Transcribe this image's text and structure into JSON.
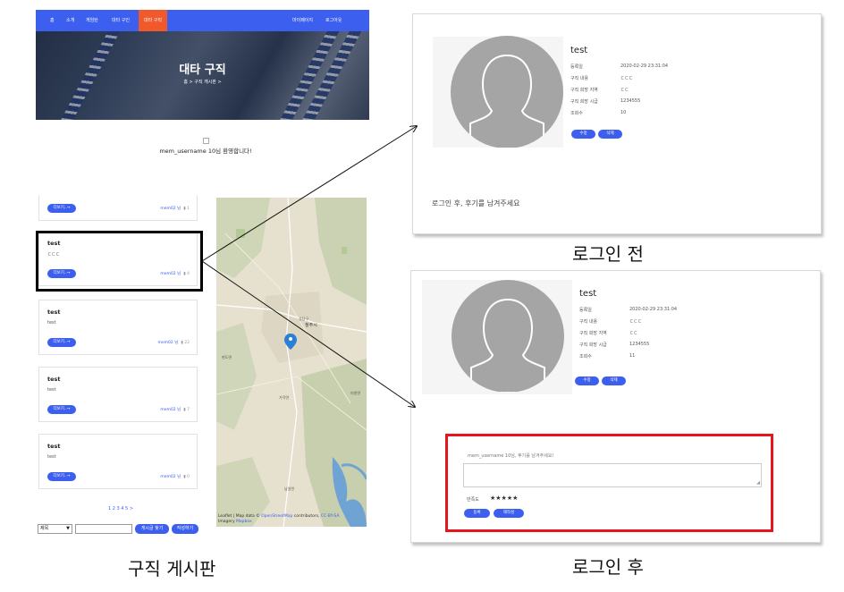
{
  "nav": {
    "items": [
      "홈",
      "소개",
      "게임탄",
      "대타 구인",
      "대타 구직",
      "마이페이지",
      "로그아웃"
    ],
    "active_label": "대타 구직"
  },
  "hero": {
    "title": "대타 구직",
    "breadcrumb": "홈 > 구직 게시판 >"
  },
  "welcome": {
    "text": "mem_username 10님 환영합니다!"
  },
  "board": {
    "more_label": "더보기..→",
    "top_card": {
      "author": "mem02 님",
      "count": "1"
    },
    "cards": [
      {
        "title": "test",
        "content": "ㄷㄷㄷ",
        "author": "mem02 님",
        "count": "4"
      },
      {
        "title": "test",
        "content": "test",
        "author": "mem02 님",
        "count": "22"
      },
      {
        "title": "test",
        "content": "test",
        "author": "mem02 님",
        "count": "7"
      },
      {
        "title": "test",
        "content": "test",
        "author": "mem02 님",
        "count": "0"
      }
    ],
    "pagination": "1 2 3 4 5 >",
    "search_select": "제목",
    "search_button": "게시글 찾기",
    "write_button": "작성하기"
  },
  "map": {
    "labels": [
      "청주시",
      "상당구",
      "가덕면",
      "현도면",
      "남일면",
      "미원면"
    ],
    "attribution_prefix": "Leaflet | Map data © ",
    "attribution_osm": "OpenStreetMap",
    "attribution_mid": " contributors, ",
    "attribution_license": "CC-BY-SA",
    "attribution_imagery": "Imagery ",
    "attribution_mapbox": "Mapbox"
  },
  "captions": {
    "board": "구직 게시판",
    "before": "로그인 전",
    "after": "로그인 후"
  },
  "before": {
    "title": "test",
    "rows": [
      {
        "label": "등록일",
        "value": "2020-02-29 23:31:04"
      },
      {
        "label": "구직 내용",
        "value": "ㄷㄷㄷ"
      },
      {
        "label": "구직 희망 지역",
        "value": "ㄷㄷ"
      },
      {
        "label": "구직 희망 시급",
        "value": "1234555"
      },
      {
        "label": "조회수",
        "value": "10"
      }
    ],
    "edit_label": "수정",
    "delete_label": "삭제",
    "login_prompt": "로그인 후, 후기를 남겨주세요"
  },
  "after": {
    "title": "test",
    "rows": [
      {
        "label": "등록일",
        "value": "2020-02-29 23:31:04"
      },
      {
        "label": "구직 내용",
        "value": "ㄷㄷㄷ"
      },
      {
        "label": "구직 희망 지역",
        "value": "ㄷㄷ"
      },
      {
        "label": "구직 희망 시급",
        "value": "1234555"
      },
      {
        "label": "조회수",
        "value": "11"
      }
    ],
    "edit_label": "수정",
    "delete_label": "삭제",
    "review_placeholder": "mem_username 10님, 후기를 남겨주세요!",
    "rating_label": "만족도",
    "stars": "★★★★★",
    "register_label": "등록",
    "rewrite_label": "재작성"
  },
  "colors": {
    "brand_blue": "#3c5ff0",
    "active_orange": "#f0592b",
    "highlight_red": "#e8141b"
  }
}
